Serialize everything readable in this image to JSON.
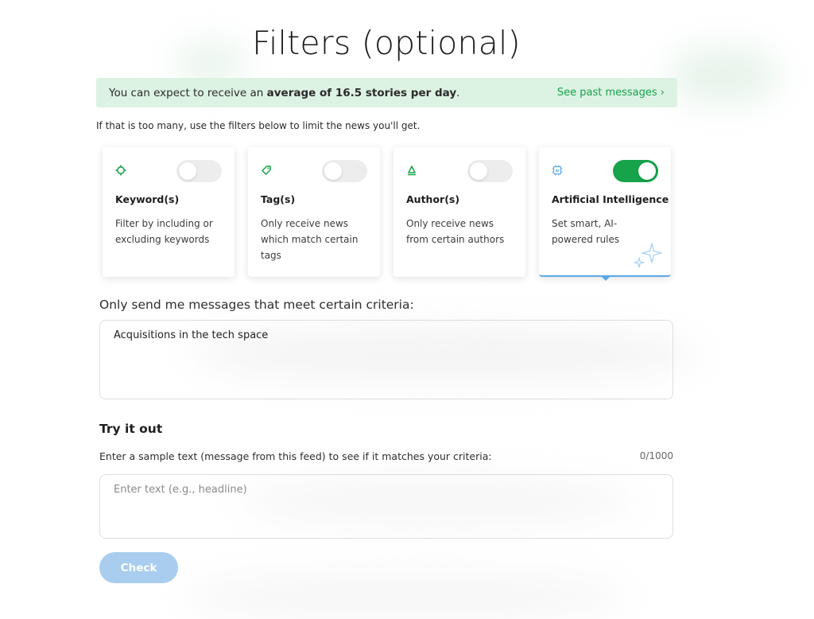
{
  "page": {
    "title": "Filters (optional)"
  },
  "banner": {
    "prefix": "You can expect to receive an ",
    "bold": "average of 16.5 stories per day",
    "suffix": ".",
    "link": "See past messages ›"
  },
  "hint": "If that is too many, use the filters below to limit the news you'll get.",
  "cards": [
    {
      "title": "Keyword(s)",
      "description": "Filter by including or excluding keywords",
      "enabled": false,
      "icon": "target-icon"
    },
    {
      "title": "Tag(s)",
      "description": "Only receive news which match certain tags",
      "enabled": false,
      "icon": "tag-icon"
    },
    {
      "title": "Author(s)",
      "description": "Only receive news from certain authors",
      "enabled": false,
      "icon": "author-icon"
    },
    {
      "title": "Artificial Intelligence",
      "description": "Set smart, AI-powered rules",
      "enabled": true,
      "icon": "ai-chip-icon"
    }
  ],
  "criteria": {
    "label": "Only send me messages that meet certain criteria:",
    "value": "Acquisitions in the tech space"
  },
  "try": {
    "heading": "Try it out",
    "label": "Enter a sample text (message from this feed) to see if it matches your criteria:",
    "counter": "0/1000",
    "placeholder": "Enter text (e.g., headline)",
    "button": "Check"
  },
  "colors": {
    "accent": "#16a34a",
    "banner_bg": "#dcf2e3",
    "ai_blue": "#5aa9e6",
    "button_disabled": "#a8cdee"
  }
}
